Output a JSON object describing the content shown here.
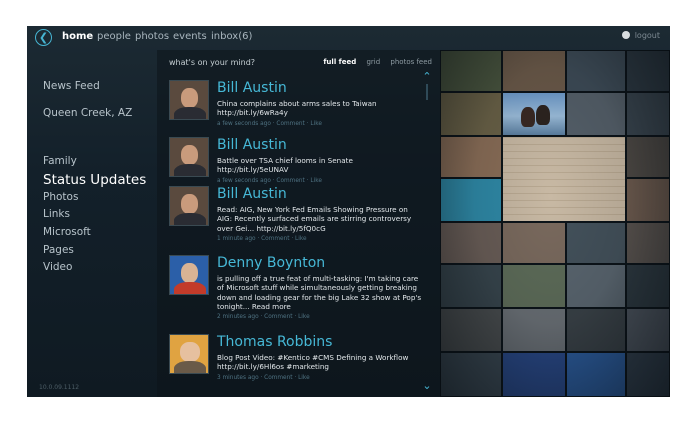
{
  "nav": {
    "back_icon": "back-arrow-icon",
    "items": [
      "home",
      "people",
      "photos",
      "events",
      "inbox(6)"
    ],
    "active": "home",
    "logout_label": "logout"
  },
  "sidebar": {
    "items": [
      "News Feed",
      "Queen Creek, AZ",
      "Family",
      "Status Updates",
      "Photos",
      "Links",
      "Microsoft",
      "Pages",
      "Video"
    ],
    "active": "Status Updates",
    "version": "10.0.09.1112"
  },
  "feed": {
    "prompt": "what's on your mind?",
    "views": [
      "full feed",
      "grid",
      "photos feed"
    ],
    "active_view": "full feed",
    "posts": [
      {
        "name": "Bill Austin",
        "text": "China complains about arms sales to Taiwan http://bit.ly/6wRa4y",
        "meta": "a few seconds ago · Comment · Like"
      },
      {
        "name": "Bill Austin",
        "text": "Battle over TSA chief looms in Senate http://bit.ly/5eUNAV",
        "meta": "a few seconds ago · Comment · Like"
      },
      {
        "name": "Bill Austin",
        "text": "Read: AIG, New York Fed Emails Showing Pressure on AIG: Recently surfaced emails are stirring controversy over Gei... http://bit.ly/5fQ0cG",
        "meta": "1 minute ago · Comment · Like"
      },
      {
        "name": "Denny Boynton",
        "text": "is pulling off a true feat of multi-tasking: I'm taking care of Microsoft stuff while simultaneously getting breaking down and loading gear for the big Lake 32 show at Pop's tonight... Read more",
        "meta": "2 minutes ago · Comment · Like"
      },
      {
        "name": "Thomas Robbins",
        "text": "Blog Post Video: #Kentico #CMS Defining a Workflow http://bit.ly/6Hl6os #marketing",
        "meta": "3 minutes ago · Comment · Like"
      }
    ]
  },
  "colors": {
    "accent": "#46b4d2",
    "background": "#13202a",
    "text": "#e3e8eb"
  }
}
